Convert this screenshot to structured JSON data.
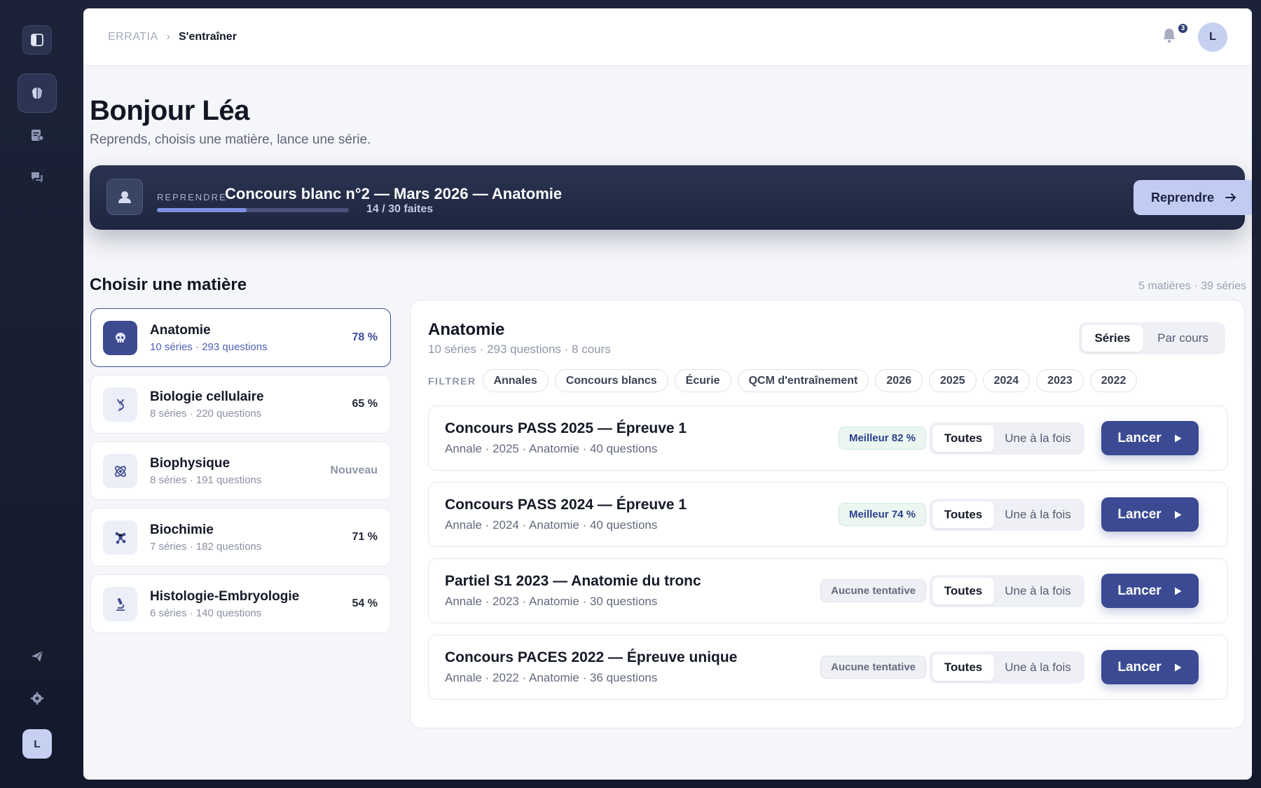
{
  "sidebar": {
    "icons": [
      "sidebar-toggle-icon",
      "brain-icon",
      "exam-list-icon",
      "chat-icon",
      "send-icon",
      "gear-icon"
    ],
    "avatar_initial": "L"
  },
  "topbar": {
    "breadcrumb_root": "ERRATIA",
    "breadcrumb_current": "S'entraîner",
    "notification_count": "3",
    "avatar_initial": "L"
  },
  "greeting": {
    "title": "Bonjour Léa",
    "subtitle": "Reprends, choisis une matière, lance une série."
  },
  "resume": {
    "kicker": "REPRENDRE",
    "title": "Concours blanc n°2 — Mars 2026 — Anatomie",
    "done": 14,
    "total": 30,
    "progress_text": "14 / 30 faites",
    "button_label": "Reprendre"
  },
  "subjects_section": {
    "title": "Choisir une matière",
    "counts": "5 matières · 39 séries",
    "items": [
      {
        "name": "Anatomie",
        "meta": "10 séries · 293 questions",
        "score": "78 %",
        "icon": "skull-icon",
        "selected": true
      },
      {
        "name": "Biologie cellulaire",
        "meta": "8 séries · 220 questions",
        "score": "65 %",
        "icon": "dna-icon",
        "selected": false
      },
      {
        "name": "Biophysique",
        "meta": "8 séries · 191 questions",
        "score": "Nouveau",
        "icon": "atom-icon",
        "selected": false
      },
      {
        "name": "Biochimie",
        "meta": "7 séries · 182 questions",
        "score": "71 %",
        "icon": "molecule-icon",
        "selected": false
      },
      {
        "name": "Histologie-Embryologie",
        "meta": "6 séries · 140 questions",
        "score": "54 %",
        "icon": "microscope-icon",
        "selected": false
      }
    ]
  },
  "detail": {
    "title": "Anatomie",
    "subtitle": "10 séries · 293 questions · 8 cours",
    "view_options": [
      "Séries",
      "Par cours"
    ],
    "view_selected": "Séries",
    "filter_label": "FILTRER",
    "filters": [
      "Annales",
      "Concours blancs",
      "Écurie",
      "QCM d'entraînement",
      "2026",
      "2025",
      "2024",
      "2023",
      "2022"
    ],
    "mode_options": [
      "Toutes",
      "Une à la fois"
    ],
    "launch_label": "Lancer",
    "series": [
      {
        "title": "Concours PASS 2025 — Épreuve 1",
        "meta": "Annale · 2025 · Anatomie · 40 questions",
        "badge": "Meilleur 82 %",
        "badge_type": "best",
        "mode": "Toutes"
      },
      {
        "title": "Concours PASS 2024 — Épreuve 1",
        "meta": "Annale · 2024 · Anatomie · 40 questions",
        "badge": "Meilleur 74 %",
        "badge_type": "best",
        "mode": "Toutes"
      },
      {
        "title": "Partiel S1 2023 — Anatomie du tronc",
        "meta": "Annale · 2023 · Anatomie · 30 questions",
        "badge": "Aucune tentative",
        "badge_type": "none",
        "mode": "Toutes"
      },
      {
        "title": "Concours PACES 2022 — Épreuve unique",
        "meta": "Annale · 2022 · Anatomie · 36 questions",
        "badge": "Aucune tentative",
        "badge_type": "none",
        "mode": "Toutes"
      }
    ]
  },
  "colors": {
    "accent": "#3b4a93",
    "banner": "#1e2640",
    "progress": "#7e8fe3",
    "success_bg": "#eaf6ef"
  }
}
